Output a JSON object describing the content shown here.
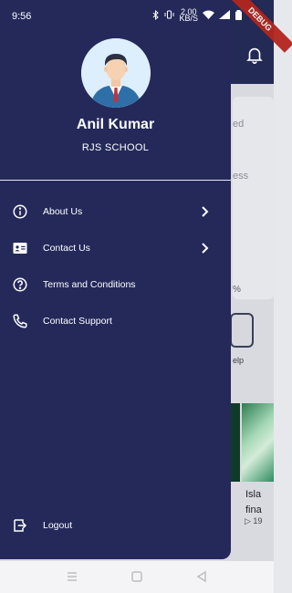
{
  "status_bar": {
    "time": "9:56",
    "net_speed_value": "2.00",
    "net_speed_unit": "KB/S"
  },
  "debug_banner": "DEBUG",
  "drawer": {
    "user_name": "Anil Kumar",
    "school_name": "RJS SCHOOL",
    "menu_items": [
      {
        "label": "About Us",
        "icon": "info-icon",
        "has_chevron": true
      },
      {
        "label": "Contact Us",
        "icon": "contact-card-icon",
        "has_chevron": true
      },
      {
        "label": "Terms and Conditions",
        "icon": "help-circle-icon",
        "has_chevron": false
      },
      {
        "label": "Contact Support",
        "icon": "phone-icon",
        "has_chevron": false
      }
    ],
    "logout_label": "Logout"
  },
  "background": {
    "partial_text_1": "ed",
    "partial_text_2": "ess",
    "percent_sign": "%",
    "help_text": "elp",
    "card_title_line1": "Isla",
    "card_title_line2": "fina",
    "card_meta": "▷ 19"
  },
  "colors": {
    "drawer_bg": "#24295a",
    "header_bg": "#232a55",
    "avatar_bg": "#ddeefc"
  }
}
